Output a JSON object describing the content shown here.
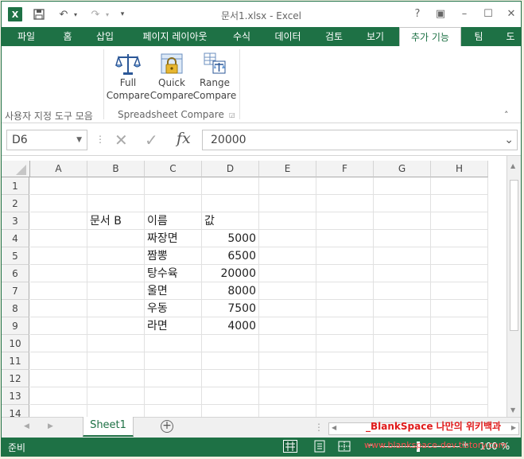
{
  "title": "문서1.xlsx - Excel",
  "ribbon_tabs": [
    "파일",
    "홈",
    "삽입",
    "페이지 레이아웃",
    "수식",
    "데이터",
    "검토",
    "보기",
    "추가 기능",
    "팀",
    "도"
  ],
  "active_tab": "추가 기능",
  "ribbon": {
    "group1_label": "사용자 지정 도구 모음",
    "group2_label": "Spreadsheet Compare",
    "buttons": [
      {
        "line1": "Full",
        "line2": "Compare",
        "icon": "balance-scale-icon"
      },
      {
        "line1": "Quick",
        "line2": "Compare",
        "icon": "lock-compare-icon"
      },
      {
        "line1": "Range",
        "line2": "Compare",
        "icon": "range-compare-icon"
      }
    ]
  },
  "formula_bar": {
    "name_box": "D6",
    "value": "20000",
    "fx": "fx"
  },
  "columns": [
    "A",
    "B",
    "C",
    "D",
    "E",
    "F",
    "G",
    "H"
  ],
  "rows": [
    "1",
    "2",
    "3",
    "4",
    "5",
    "6",
    "7",
    "8",
    "9",
    "10",
    "11",
    "12",
    "13",
    "14"
  ],
  "cells": {
    "B3": "문서 B",
    "C3": "이름",
    "D3": "값",
    "C4": "짜장면",
    "D4": "5000",
    "C5": "짬뽕",
    "D5": "6500",
    "C6": "탕수육",
    "D6": "20000",
    "C7": "울면",
    "D7": "8000",
    "C8": "우동",
    "D8": "7500",
    "C9": "라면",
    "D9": "4000"
  },
  "sheet_tab": "Sheet1",
  "status": {
    "left": "준비",
    "zoom": "100 %"
  },
  "watermark": {
    "line1": "_BlankSpace 나만의 위키백과",
    "line2": "www.blankspace-dev.tistory.com"
  },
  "colors": {
    "accent": "#1e7145"
  }
}
